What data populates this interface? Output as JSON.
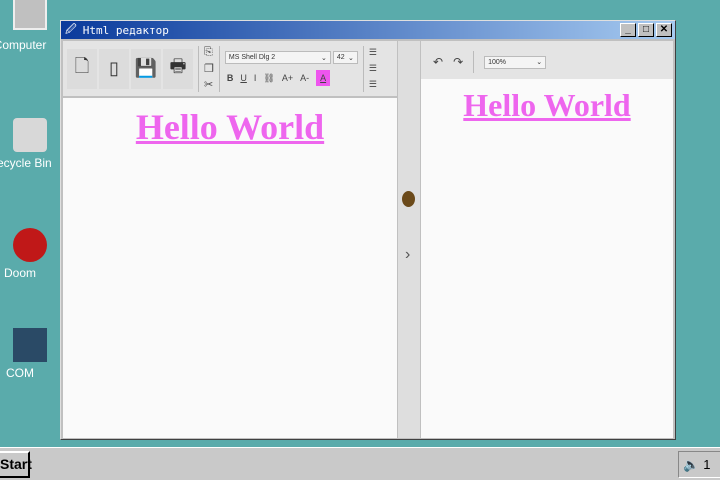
{
  "desktop": {
    "icons": [
      {
        "label": "Computer"
      },
      {
        "label": "Recycle Bin"
      },
      {
        "label": "Doom"
      },
      {
        "label": "COM"
      }
    ]
  },
  "window": {
    "title": "Html редактор",
    "min": "_",
    "max": "□",
    "close": "✕"
  },
  "toolbar": {
    "font": "MS Shell Dlg 2",
    "size": "42",
    "bold": "B",
    "underline": "U",
    "italic": "I",
    "grow": "A+",
    "shrink": "A-",
    "color": "A",
    "accent": "#ee55ee"
  },
  "editor": {
    "text": "Hello World"
  },
  "preview": {
    "zoom": "100%",
    "text": "Hello World"
  },
  "splitter": {
    "arrow": "›"
  },
  "taskbar": {
    "start": "Start",
    "clock": "1"
  }
}
